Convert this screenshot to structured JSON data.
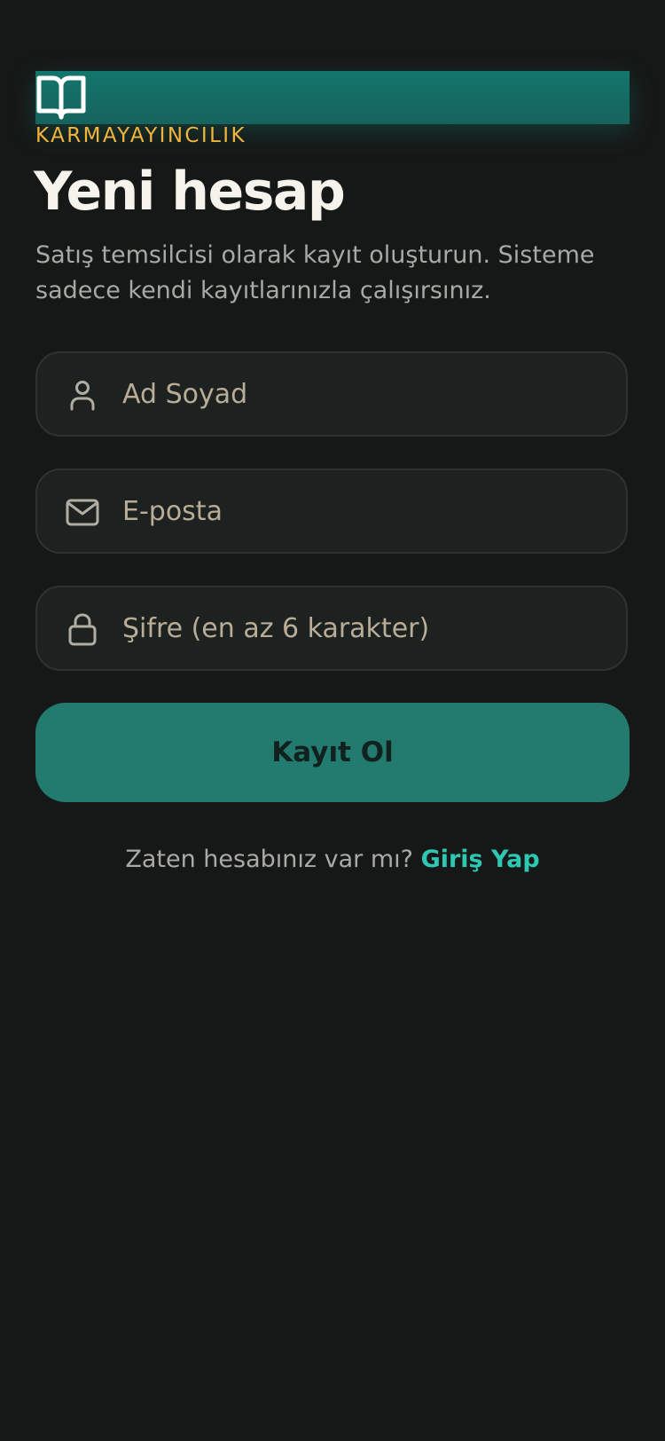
{
  "brand": {
    "name": "KARMAYAYINCILIK",
    "icon": "open-book-icon"
  },
  "header": {
    "title": "Yeni hesap",
    "subtitle": "Satış temsilcisi olarak kayıt oluşturun. Sisteme sadece kendi kayıtlarınızla çalışırsınız."
  },
  "form": {
    "name_field": {
      "placeholder": "Ad Soyad",
      "value": "",
      "icon": "user-icon"
    },
    "email_field": {
      "placeholder": "E-posta",
      "value": "",
      "icon": "mail-icon"
    },
    "password_field": {
      "placeholder": "Şifre (en az 6 karakter)",
      "value": "",
      "icon": "lock-icon"
    },
    "submit_label": "Kayıt Ol"
  },
  "footer": {
    "prompt": "Zaten hesabınız var mı?",
    "login_link": "Giriş Yap"
  },
  "colors": {
    "background": "#161817",
    "accent": "#237a6e",
    "brand_gold": "#f0b53a",
    "link": "#2ec7b2"
  }
}
